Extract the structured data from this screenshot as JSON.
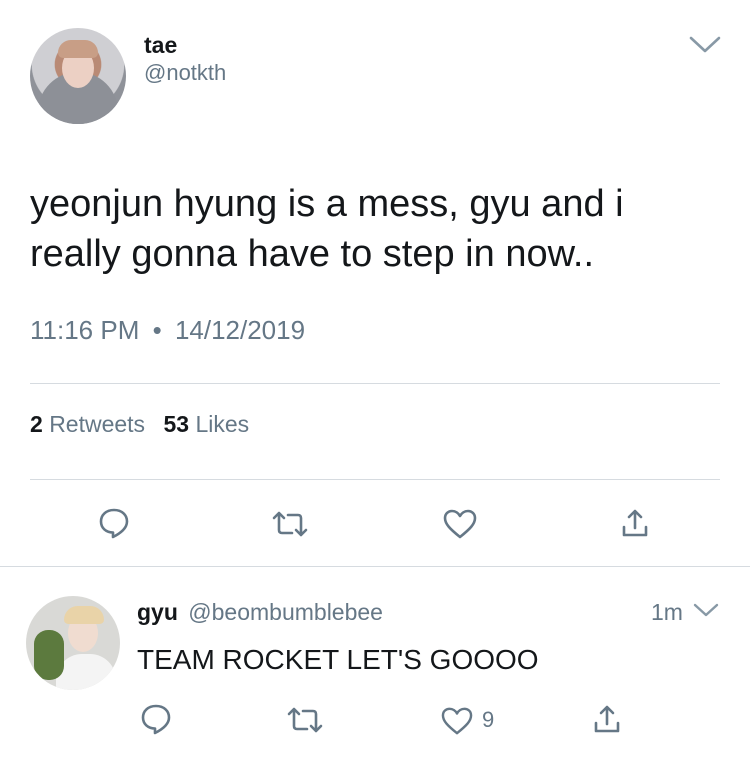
{
  "tweet": {
    "author_name": "tae",
    "author_handle": "@notkth",
    "text_line1": "yeonjun hyung is a mess, gyu and i",
    "text_line2": "really gonna have to step in now..",
    "time": "11:16 PM",
    "separator": "•",
    "date": "14/12/2019",
    "retweets_count": "2",
    "retweets_label": "Retweets",
    "likes_count": "53",
    "likes_label": "Likes"
  },
  "reply": {
    "author_name": "gyu",
    "author_handle": "@beombumblebee",
    "timestamp": "1m",
    "text": "TEAM ROCKET LET'S GOOOO",
    "likes_count": "9"
  },
  "icons": {
    "caret": "chevron-down-icon",
    "reply": "reply-bubble-icon",
    "retweet": "retweet-icon",
    "like": "heart-icon",
    "share": "share-icon"
  },
  "colors": {
    "text": "#14171a",
    "muted": "#657786",
    "divider": "#d6dbe0",
    "icon": "#657786"
  }
}
